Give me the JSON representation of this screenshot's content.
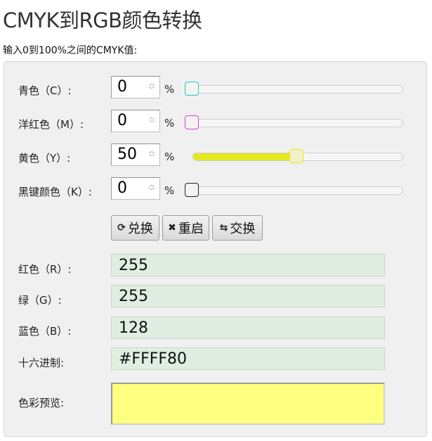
{
  "page": {
    "title": "CMYK到RGB颜色转换",
    "instruction": "输入0到100%之间的CMYK值:"
  },
  "inputs": [
    {
      "label": "青色（C）:",
      "value": "0",
      "unit": "%",
      "level_percent": 0,
      "color": "#22c8c8"
    },
    {
      "label": "洋红色（M）:",
      "value": "0",
      "unit": "%",
      "level_percent": 0,
      "color": "#e23fd3"
    },
    {
      "label": "黄色（Y）:",
      "value": "50",
      "unit": "%",
      "level_percent": 50,
      "color": "#e6e81f"
    },
    {
      "label": "黑键颜色（K）:",
      "value": "0",
      "unit": "%",
      "level_percent": 0,
      "color": "#222222"
    }
  ],
  "buttons": [
    {
      "icon": "refresh-icon",
      "glyph": "⟳",
      "label": "兑换"
    },
    {
      "icon": "close-icon",
      "glyph": "✖",
      "label": "重启"
    },
    {
      "icon": "swap-icon",
      "glyph": "⇆",
      "label": "交换"
    }
  ],
  "results": [
    {
      "label": "红色（R）:",
      "value": "255"
    },
    {
      "label": "绿（G）:",
      "value": "255"
    },
    {
      "label": "蓝色（B）:",
      "value": "128"
    },
    {
      "label": "十六进制:",
      "value": "#FFFF80"
    }
  ],
  "preview": {
    "label": "色彩预览:",
    "color": "#FFFF80"
  }
}
